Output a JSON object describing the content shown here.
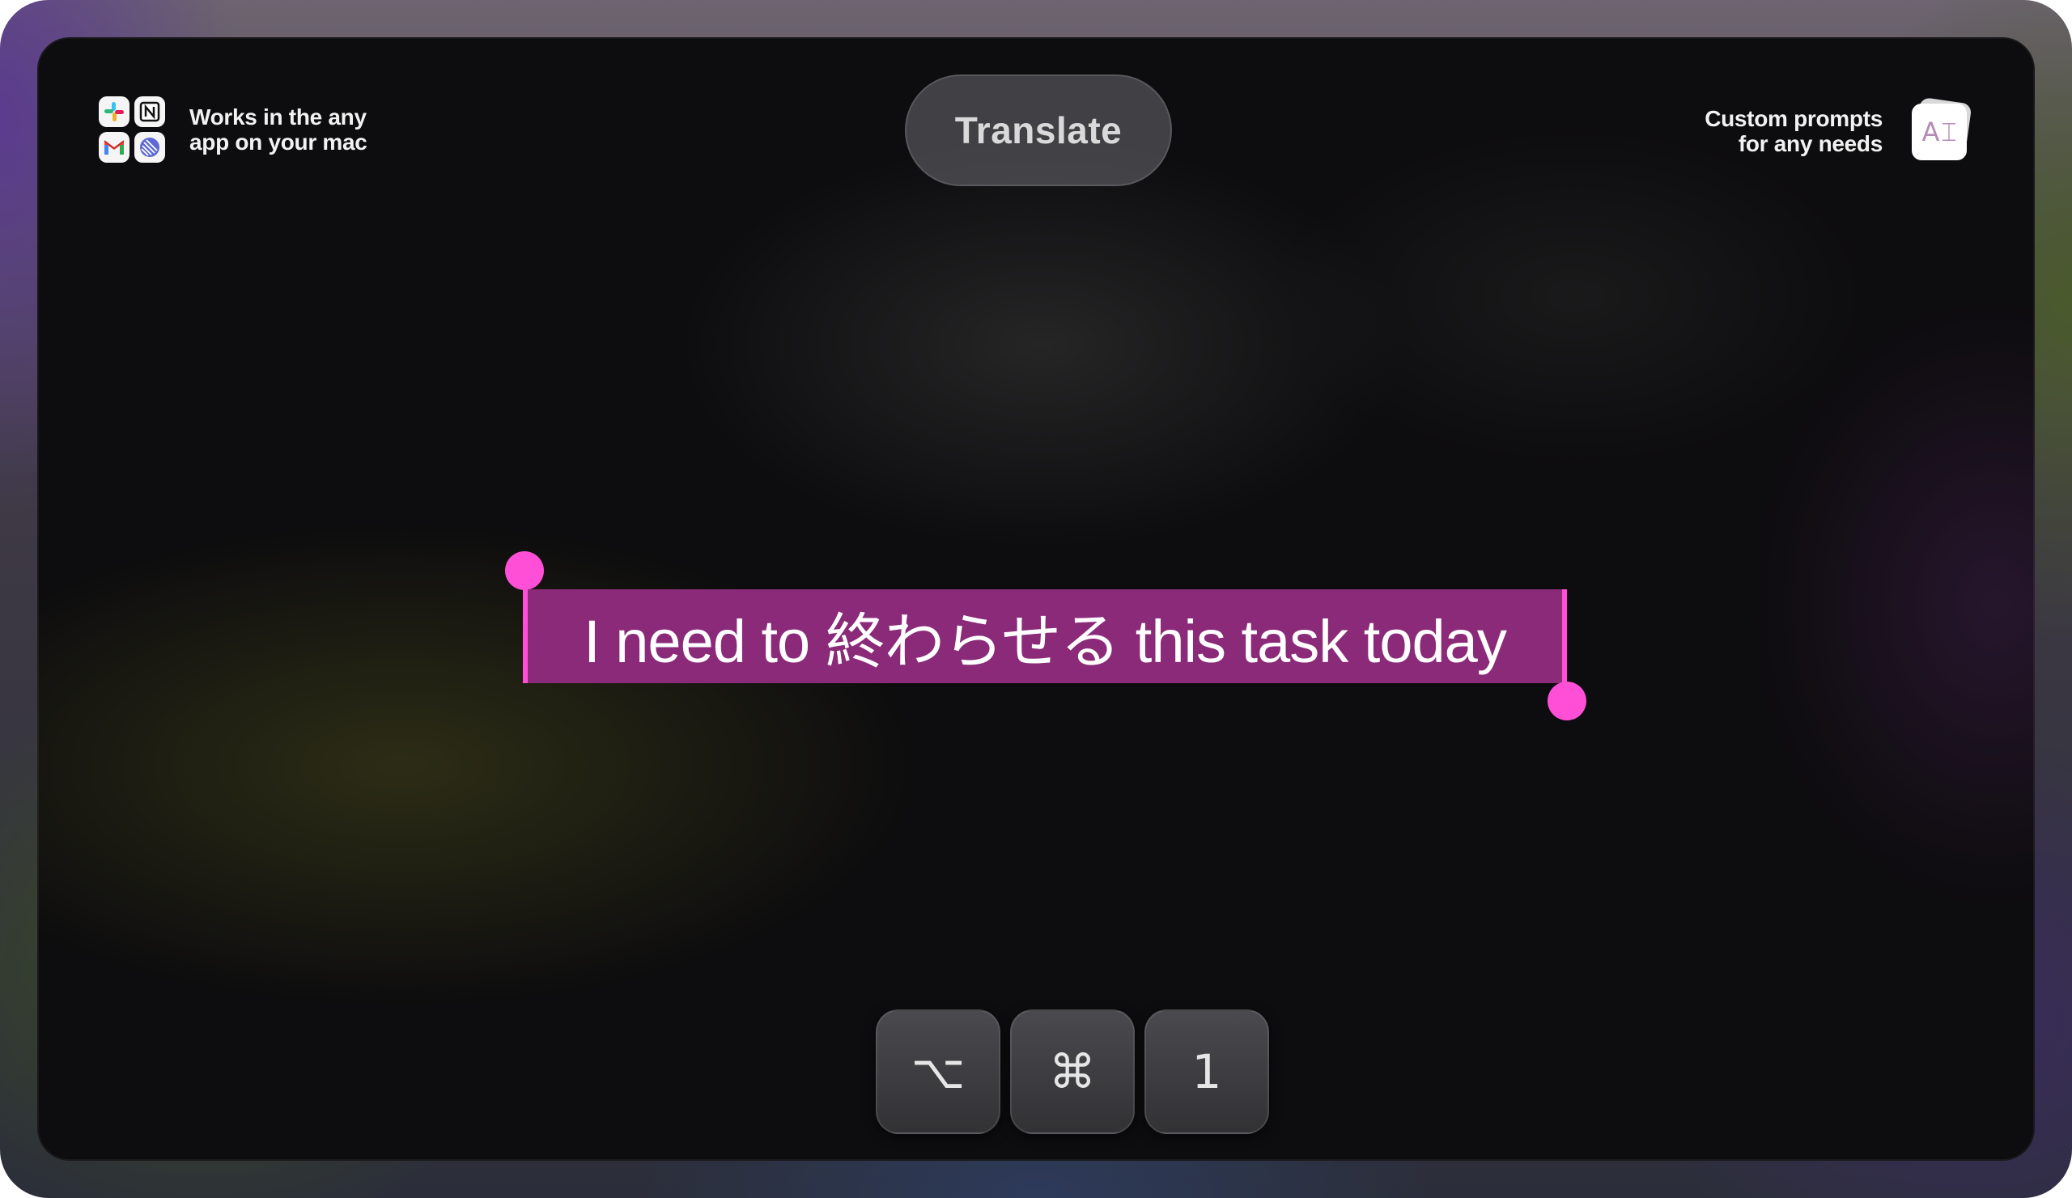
{
  "left_feature": {
    "line1": "Works in the any",
    "line2": "app on your mac",
    "apps": [
      {
        "name": "slack-icon"
      },
      {
        "name": "notion-icon"
      },
      {
        "name": "gmail-icon"
      },
      {
        "name": "linear-icon"
      }
    ]
  },
  "right_feature": {
    "line1": "Custom prompts",
    "line2": "for any needs",
    "icon_text": "A",
    "icon_name": "ai-prompt-icon"
  },
  "action": {
    "label": "Translate"
  },
  "selection": {
    "text": "I need to 終わらせる this task today"
  },
  "shortcut": {
    "keys": [
      "⌥",
      "⌘",
      "1"
    ]
  },
  "colors": {
    "selection_highlight": "#8a2a78",
    "selection_handle": "#ff4fd6"
  }
}
